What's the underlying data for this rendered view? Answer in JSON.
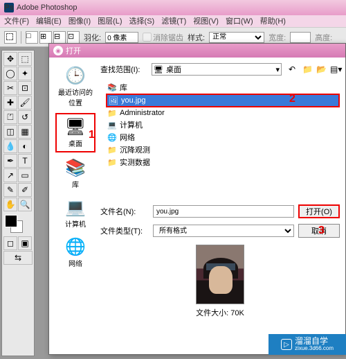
{
  "app": {
    "title": "Adobe Photoshop"
  },
  "menu": {
    "file": "文件(F)",
    "edit": "编辑(E)",
    "image": "图像(I)",
    "layer": "图层(L)",
    "select": "选择(S)",
    "filter": "滤镜(T)",
    "view": "视图(V)",
    "window": "窗口(W)",
    "help": "帮助(H)"
  },
  "options": {
    "feather_label": "羽化:",
    "feather_value": "0 像素",
    "antialias": "消除锯齿",
    "style_label": "样式:",
    "style_value": "正常",
    "width_label": "宽度:",
    "height_label": "高度:"
  },
  "dialog": {
    "title": "打开",
    "lookin_label": "查找范围(I):",
    "lookin_value": "桌面",
    "places": {
      "recent": "最近访问的位置",
      "desktop": "桌面",
      "libraries": "库",
      "computer": "计算机",
      "network": "网络"
    },
    "files": [
      {
        "icon": "library",
        "name": "库"
      },
      {
        "icon": "image",
        "name": "you.jpg",
        "selected": true
      },
      {
        "icon": "folder-user",
        "name": "Administrator"
      },
      {
        "icon": "computer",
        "name": "计算机"
      },
      {
        "icon": "network",
        "name": "网络"
      },
      {
        "icon": "folder",
        "name": "沉降观测"
      },
      {
        "icon": "folder",
        "name": "实测数据"
      }
    ],
    "filename_label": "文件名(N):",
    "filename_value": "you.jpg",
    "filetype_label": "文件类型(T):",
    "filetype_value": "所有格式",
    "open_btn": "打开(O)",
    "cancel_btn": "取消",
    "filesize_label": "文件大小:",
    "filesize_value": "70K"
  },
  "annotations": {
    "a1": "1",
    "a2": "2",
    "a3": "3"
  },
  "watermark": {
    "brand": "溜溜自学",
    "url": "zixue.3d66.com"
  }
}
